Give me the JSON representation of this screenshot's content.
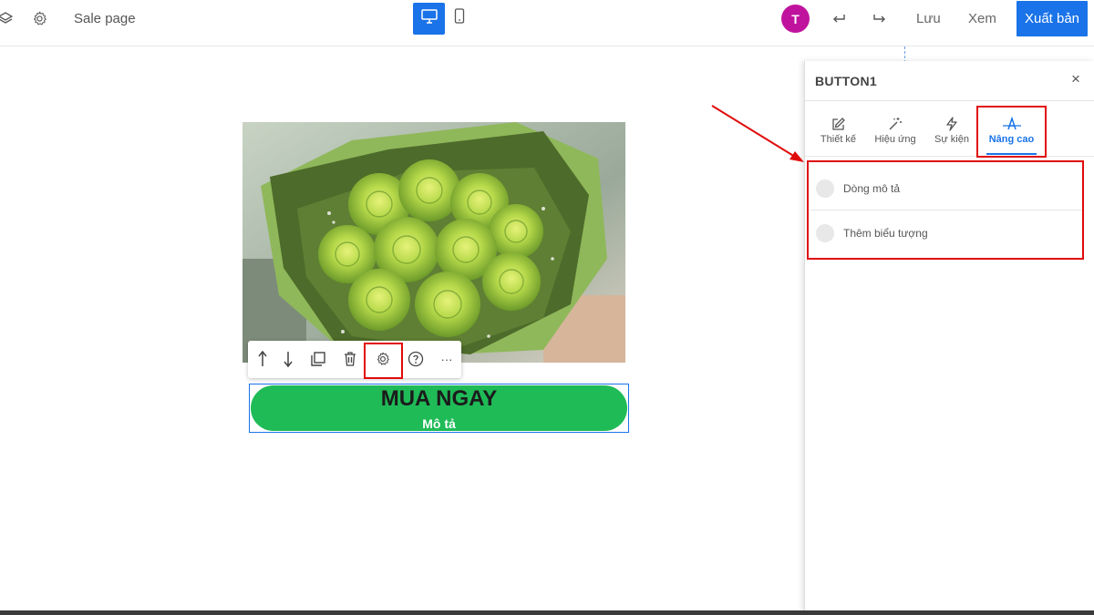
{
  "topbar": {
    "page_name": "Sale page",
    "avatar_initial": "T",
    "save_label": "Lưu",
    "preview_label": "Xem",
    "publish_label": "Xuất bản",
    "icons": [
      "layers-icon",
      "gear-icon",
      "desktop-icon",
      "mobile-icon",
      "undo-icon",
      "redo-icon"
    ]
  },
  "canvas": {
    "image": {
      "subject": "green rose bouquet",
      "icon": "image"
    },
    "toolbar_icons": [
      "move-up-icon",
      "move-down-icon",
      "duplicate-icon",
      "delete-icon",
      "settings-icon",
      "help-icon",
      "more-icon"
    ],
    "toolbar_more_glyph": "···",
    "button": {
      "label": "MUA NGAY",
      "sublabel": "Mô tả",
      "color": "#1fbb57"
    }
  },
  "panel": {
    "title": "BUTTON1",
    "close_glyph": "×",
    "tabs": [
      {
        "label": "Thiết kế",
        "icon": "edit-icon"
      },
      {
        "label": "Hiệu ứng",
        "icon": "magic-wand-icon"
      },
      {
        "label": "Sự kiện",
        "icon": "lightning-icon"
      },
      {
        "label": "Nâng cao",
        "icon": "advanced-icon",
        "active": true
      }
    ],
    "options": [
      {
        "label": "Dòng mô tả",
        "enabled": false
      },
      {
        "label": "Thêm biểu tượng",
        "enabled": false
      }
    ]
  },
  "colors": {
    "accent": "#1a73e8",
    "avatar": "#c0139d",
    "annotation": "#e00b0b",
    "button_green": "#1fbb57"
  }
}
